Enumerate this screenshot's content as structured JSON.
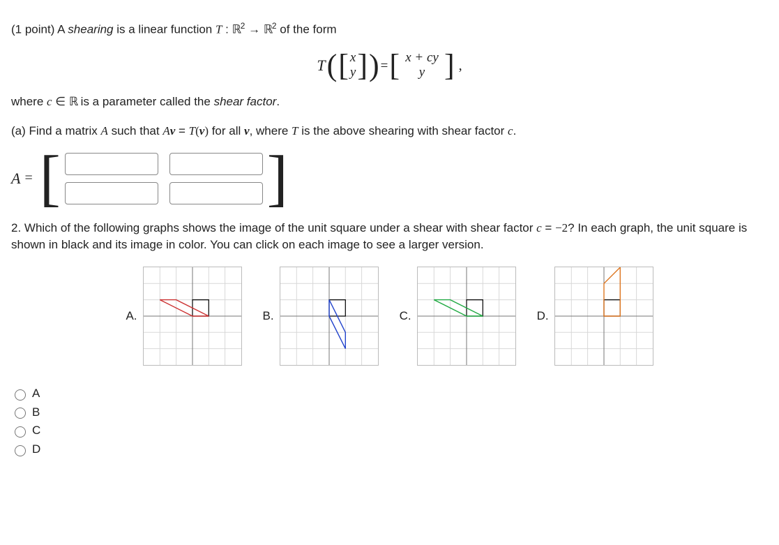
{
  "intro": {
    "points": "(1 point)",
    "pre": " A ",
    "term": "shearing",
    "mid1": " is a linear function ",
    "T": "T",
    "colon": " : ",
    "R2a": "ℝ",
    "sup2a": "2",
    "arrow": " → ",
    "R2b": "ℝ",
    "sup2b": "2",
    "post": " of the form"
  },
  "formula": {
    "T": "T",
    "lp": "(",
    "x": "x",
    "y": "y",
    "rp": ")",
    "eq": " = ",
    "r1": "x + cy",
    "r2": "y",
    "comma": ","
  },
  "where": {
    "pre": "where ",
    "c": "c",
    "in": " ∈ ",
    "R": "ℝ",
    "mid": " is a parameter called the ",
    "term": "shear factor",
    "post": "."
  },
  "partA": {
    "lead": "(a) Find a matrix ",
    "A": "A",
    "mid1": " such that ",
    "Av": "A",
    "v": "v",
    "eq": " = ",
    "Tv": "T",
    "lp": "(",
    "vb": "v",
    "rp": ")",
    "mid2": " for all ",
    "vbold": "v",
    "mid3": ", where ",
    "T2": "T",
    "post": " is the above shearing with shear factor ",
    "c": "c",
    "dot": "."
  },
  "matrixLabel": {
    "A": "A",
    "eq": "="
  },
  "q2": {
    "pre": "2. Which of the following graphs shows the image of the unit square under a shear with shear factor ",
    "c": "c",
    "eq": " = ",
    "val": "−2",
    "post": "? In each graph, the unit square is shown in black and its image in color. You can click on each image to see a larger version."
  },
  "labels": {
    "A": "A.",
    "B": "B.",
    "C": "C.",
    "D": "D."
  },
  "options": {
    "A": "A",
    "B": "B",
    "C": "C",
    "D": "D"
  },
  "chart_data": [
    {
      "type": "diagram",
      "label": "A",
      "axis_range": [
        -3,
        3
      ],
      "unit_square": [
        [
          0,
          0
        ],
        [
          1,
          0
        ],
        [
          1,
          1
        ],
        [
          0,
          1
        ]
      ],
      "image_color": "#cc3333",
      "image_polygon": [
        [
          0,
          0
        ],
        [
          1,
          0
        ],
        [
          -1,
          1
        ],
        [
          -2,
          1
        ]
      ]
    },
    {
      "type": "diagram",
      "label": "B",
      "axis_range": [
        -3,
        3
      ],
      "unit_square": [
        [
          0,
          0
        ],
        [
          1,
          0
        ],
        [
          1,
          1
        ],
        [
          0,
          1
        ]
      ],
      "image_color": "#2244cc",
      "image_polygon": [
        [
          0,
          0
        ],
        [
          1,
          -2
        ],
        [
          1,
          -1
        ],
        [
          0,
          1
        ]
      ]
    },
    {
      "type": "diagram",
      "label": "C",
      "axis_range": [
        -3,
        3
      ],
      "unit_square": [
        [
          0,
          0
        ],
        [
          1,
          0
        ],
        [
          1,
          1
        ],
        [
          0,
          1
        ]
      ],
      "image_color": "#22aa44",
      "image_polygon": [
        [
          0,
          0
        ],
        [
          -2,
          1
        ],
        [
          -1,
          1
        ],
        [
          1,
          0
        ]
      ]
    },
    {
      "type": "diagram",
      "label": "D",
      "axis_range": [
        -3,
        3
      ],
      "unit_square": [
        [
          0,
          0
        ],
        [
          1,
          0
        ],
        [
          1,
          1
        ],
        [
          0,
          1
        ]
      ],
      "image_color": "#dd7722",
      "image_polygon": [
        [
          0,
          0
        ],
        [
          1,
          0
        ],
        [
          1,
          3
        ],
        [
          0,
          2
        ]
      ]
    }
  ]
}
